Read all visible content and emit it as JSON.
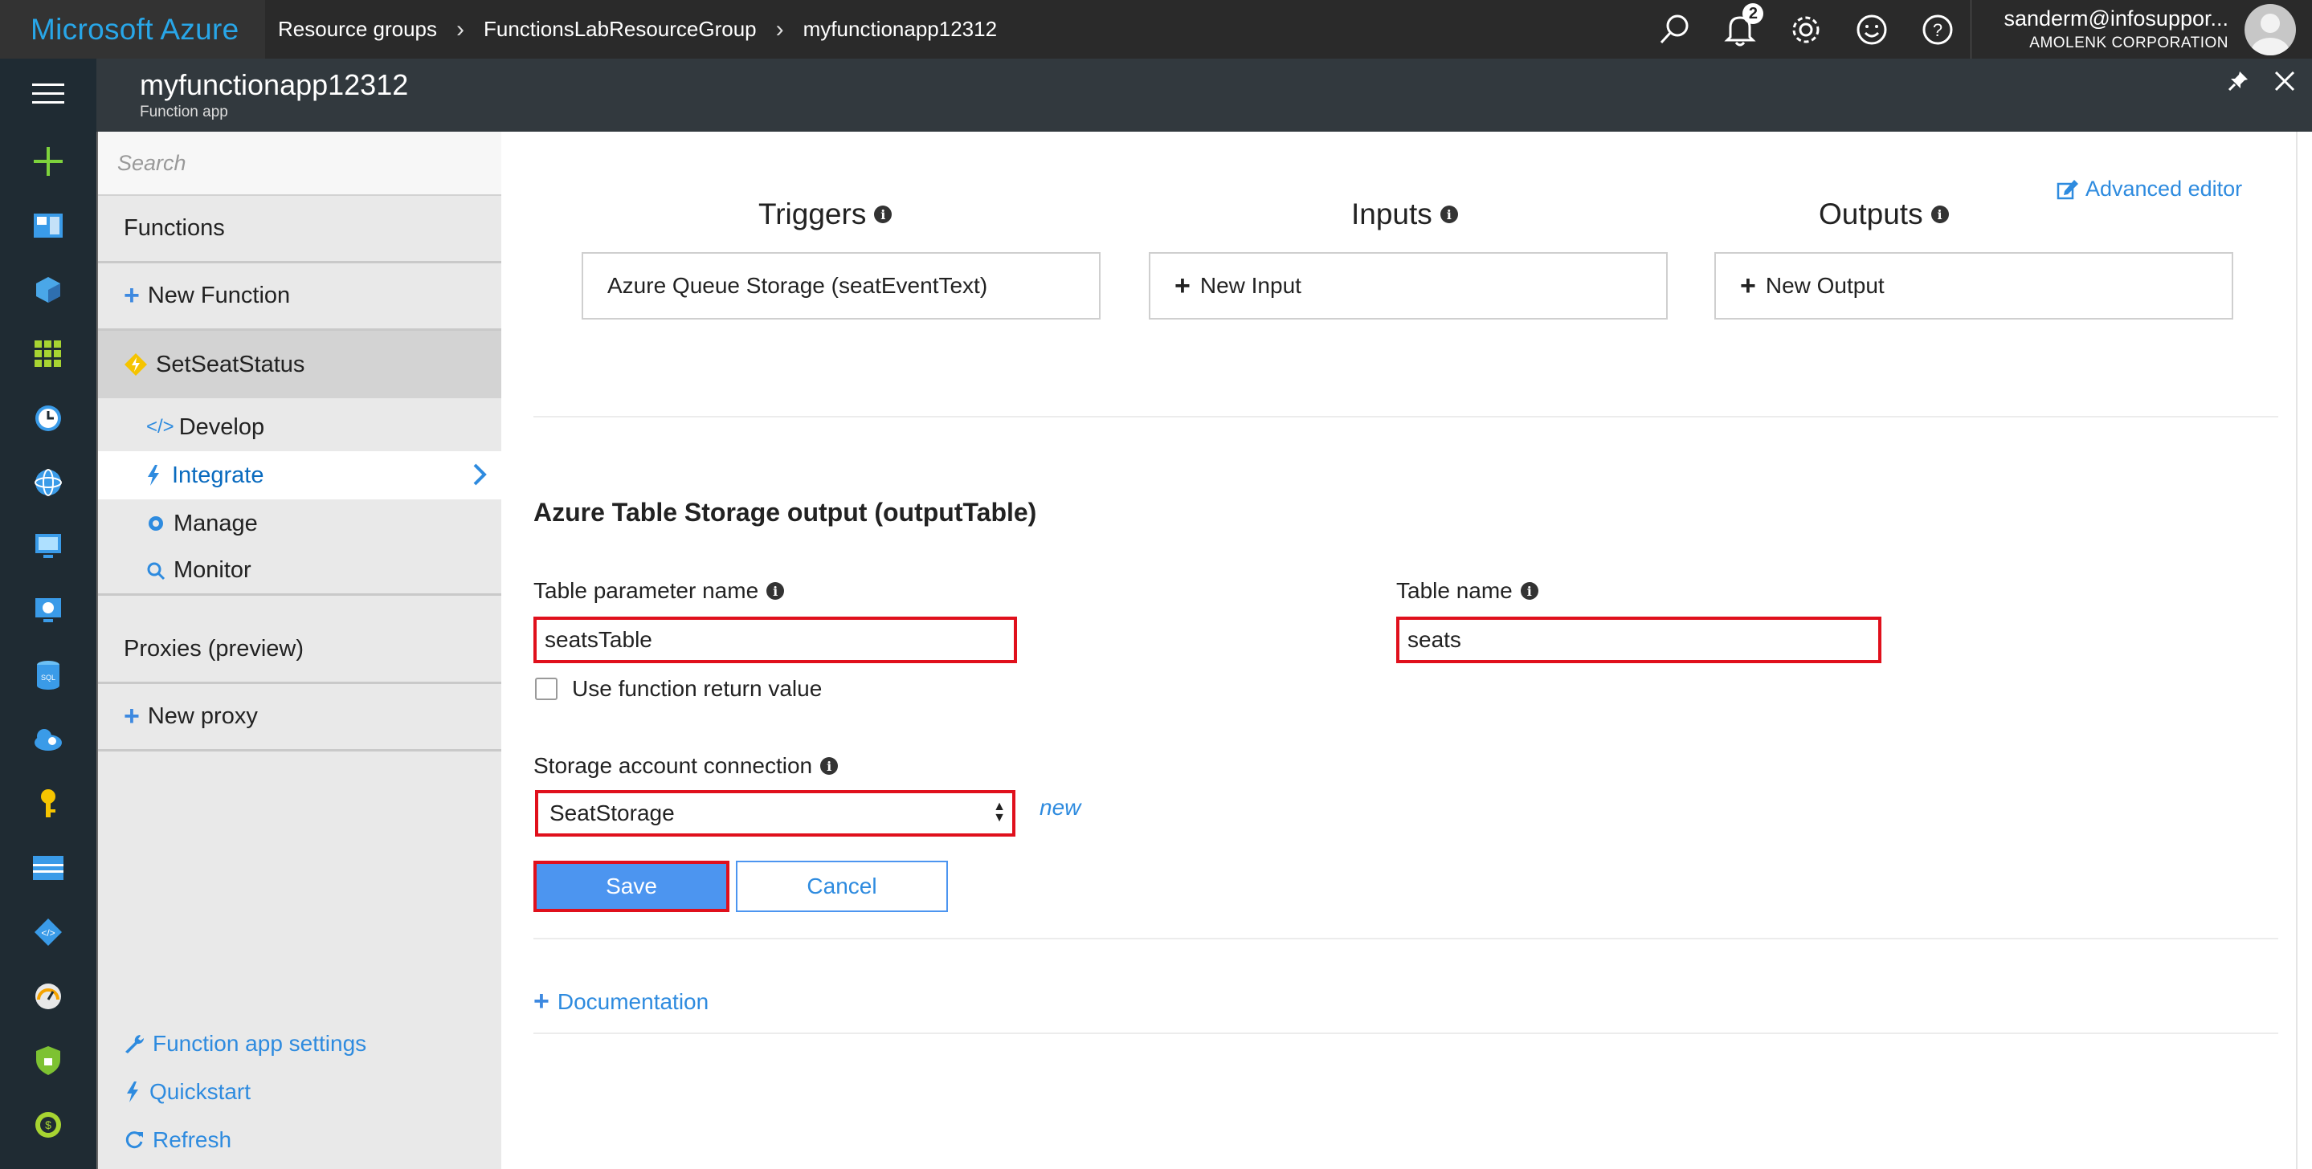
{
  "topbar": {
    "brand": "Microsoft Azure",
    "breadcrumbs": [
      "Resource groups",
      "FunctionsLabResourceGroup",
      "myfunctionapp12312"
    ],
    "notification_count": "2",
    "user_name": "sanderm@infosuppor...",
    "user_org": "AMOLENK CORPORATION"
  },
  "blade": {
    "title": "myfunctionapp12312",
    "subtitle": "Function app"
  },
  "tree": {
    "search_placeholder": "Search",
    "functions_label": "Functions",
    "new_function": "New Function",
    "function_name": "SetSeatStatus",
    "sub_items": [
      "Develop",
      "Integrate",
      "Manage",
      "Monitor"
    ],
    "proxies_label": "Proxies (preview)",
    "new_proxy": "New proxy",
    "bottom_links": [
      "Function app settings",
      "Quickstart",
      "Refresh"
    ]
  },
  "main": {
    "advanced_editor": "Advanced editor",
    "columns": {
      "triggers": "Triggers",
      "inputs": "Inputs",
      "outputs": "Outputs"
    },
    "trigger_box": "Azure Queue Storage (seatEventText)",
    "new_input": "New Input",
    "new_output": "New Output",
    "section_title": "Azure Table Storage output (outputTable)",
    "table_param_label": "Table parameter name",
    "table_param_value": "seatsTable",
    "table_name_label": "Table name",
    "table_name_value": "seats",
    "use_return_label": "Use function return value",
    "storage_conn_label": "Storage account connection",
    "storage_conn_value": "SeatStorage",
    "new_link": "new",
    "save": "Save",
    "cancel": "Cancel",
    "documentation": "Documentation"
  },
  "colors": {
    "topbar_bg": "#2a2a2a",
    "brand": "#28a6e8",
    "rail_bg": "#1f2b33",
    "link": "#2e8bdf",
    "highlight": "#e0101c",
    "save_bg": "#4c95f0"
  }
}
